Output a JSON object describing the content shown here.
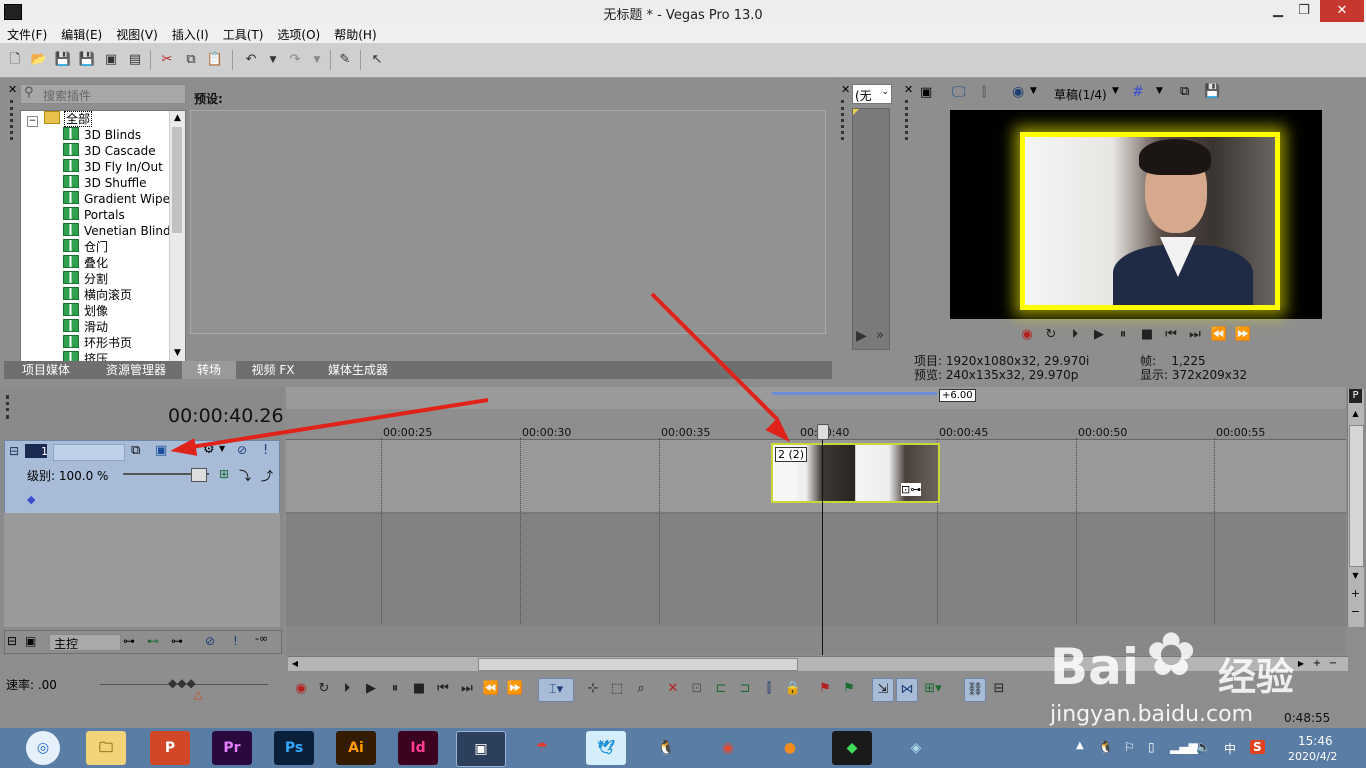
{
  "window": {
    "title": "无标题 * - Vegas Pro 13.0",
    "minimize": "▁",
    "maximize": "❐",
    "close": "✕"
  },
  "menu": [
    "文件(F)",
    "编辑(E)",
    "视图(V)",
    "插入(I)",
    "工具(T)",
    "选项(O)",
    "帮助(H)"
  ],
  "plugin_panel": {
    "search_placeholder": "搜索插件",
    "preset_label": "预设:",
    "tree": [
      "全部",
      "3D Blinds",
      "3D Cascade",
      "3D Fly In/Out",
      "3D Shuffle",
      "Gradient Wipe",
      "Portals",
      "Venetian Blinds",
      "仓门",
      "叠化",
      "分割",
      "横向滚页",
      "划像",
      "滑动",
      "环形书页",
      "挤压"
    ],
    "tabs": [
      "项目媒体",
      "资源管理器",
      "转场",
      "视频 FX",
      "媒体生成器"
    ],
    "active_tab": 2
  },
  "trimmer": {
    "dropdown": "(无"
  },
  "preview": {
    "quality": "草稿(1/4)",
    "project_label": "项目:",
    "project_value": "1920x1080x32, 29.970i",
    "preview_label": "预览:",
    "preview_value": "240x135x32, 29.970p",
    "frame_label": "帧:",
    "frame_value": "1,225",
    "display_label": "显示:",
    "display_value": "372x209x32"
  },
  "timeline": {
    "timecode": "00:00:40.26",
    "loop_marker": "+6.00",
    "ruler": [
      "00:00:25",
      "00:00:30",
      "00:00:35",
      "00:00:40",
      "00:00:45",
      "00:00:50",
      "00:00:55"
    ],
    "track_number": "1",
    "level_label": "级别: 100.0 %",
    "clip_label": "2 (2)",
    "master_label": "主控",
    "master_value": "-∞",
    "rate_label": "速率: .00"
  },
  "status": {
    "datetime_overlay": "0:48:55"
  },
  "taskbar": {
    "apps": [
      "",
      "",
      "P",
      "Pr",
      "Ps",
      "Ai",
      "Id",
      "",
      "",
      "",
      "",
      "",
      "",
      "",
      ""
    ],
    "clock_time": "15:46",
    "clock_date": "2020/4/2",
    "ime": "中",
    "ime2": "S"
  },
  "watermark": {
    "brand": "Bai",
    "brand2": "经验",
    "url": "jingyan.baidu.com"
  },
  "colors": {
    "track_blue": "#a8bcd8",
    "selection_yellow": "#ffff00",
    "arrow_red": "#e0231a"
  }
}
